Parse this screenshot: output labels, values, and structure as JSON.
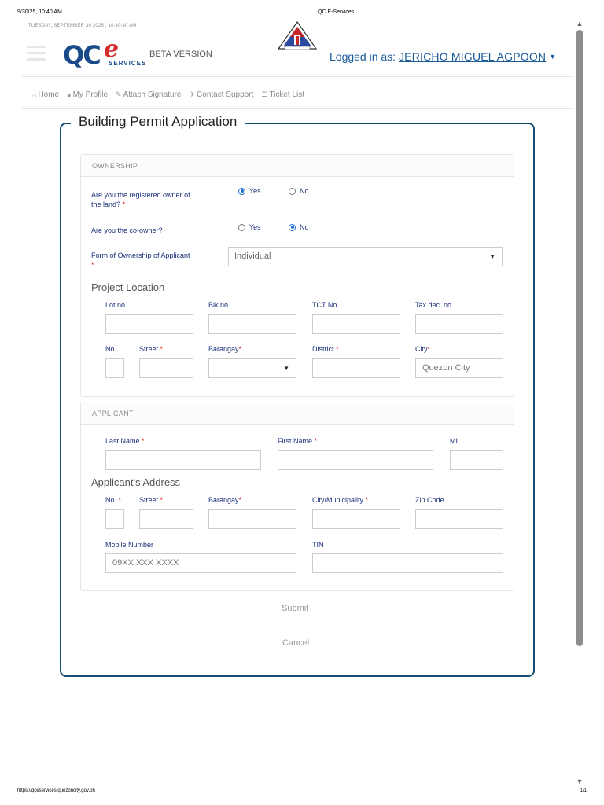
{
  "print": {
    "timestamp": "9/30/25, 10:40 AM",
    "doc_title": "QC E-Services",
    "url": "https://qceservices.quezoncity.gov.ph",
    "page": "1/1"
  },
  "header": {
    "date_line": "TUESDAY, SEPTEMBER 30 2025 , 10:40:40 AM",
    "logo": {
      "qc": "QC",
      "e": "e",
      "services": "SERVICES"
    },
    "beta": "BETA VERSION",
    "logged_in_prefix": "Logged in as: ",
    "user": "JERICHO MIGUEL AGPOON",
    "caret_icon": "caret-down-icon"
  },
  "nav": {
    "items": [
      {
        "icon": "home-icon",
        "glyph": "⌂",
        "label": "Home"
      },
      {
        "icon": "user-icon",
        "glyph": "👤",
        "label": "My Profile"
      },
      {
        "icon": "pencil-icon",
        "glyph": "✎",
        "label": "Attach Signature"
      },
      {
        "icon": "send-icon",
        "glyph": "✈",
        "label": "Contact Support"
      },
      {
        "icon": "list-icon",
        "glyph": "☰",
        "label": "Ticket List"
      }
    ]
  },
  "form": {
    "title": "Building Permit Application",
    "ownership": {
      "heading": "OWNERSHIP",
      "q1": {
        "label_line1": "Are you the registered owner of",
        "label_line2": "the land?",
        "required": "*",
        "yes": "Yes",
        "no": "No",
        "selected": "Yes"
      },
      "q2": {
        "label": "Are you the co-owner?",
        "yes": "Yes",
        "no": "No",
        "selected": "No"
      },
      "form_of_ownership": {
        "label": "Form of Ownership of Applicant",
        "required": "*",
        "value": "Individual"
      }
    },
    "project_location": {
      "title": "Project Location",
      "lot_no": "Lot no.",
      "blk_no": "Blk no.",
      "tct_no": "TCT No.",
      "tax_dec_no": "Tax dec. no.",
      "no": "No.",
      "street": "Street",
      "barangay": "Barangay",
      "district": "District",
      "city": "City",
      "city_value": "Quezon City",
      "required": "*"
    },
    "applicant": {
      "heading": "APPLICANT",
      "last_name": "Last Name",
      "first_name": "First Name",
      "mi": "MI",
      "required": "*"
    },
    "applicant_address": {
      "title": "Applicant's Address",
      "no": "No.",
      "street": "Street",
      "barangay": "Barangay",
      "city_municipality": "City/Municipality",
      "zip_code": "Zip Code",
      "mobile_number": "Mobile Number",
      "mobile_placeholder": "09XX XXX XXXX",
      "tin": "TIN",
      "required": "*"
    },
    "submit": "Submit",
    "cancel": "Cancel"
  },
  "colors": {
    "brand_blue": "#1a4a8a",
    "link_blue": "#1a5b9a",
    "border_navy": "#164d73",
    "required_red": "#d11"
  }
}
